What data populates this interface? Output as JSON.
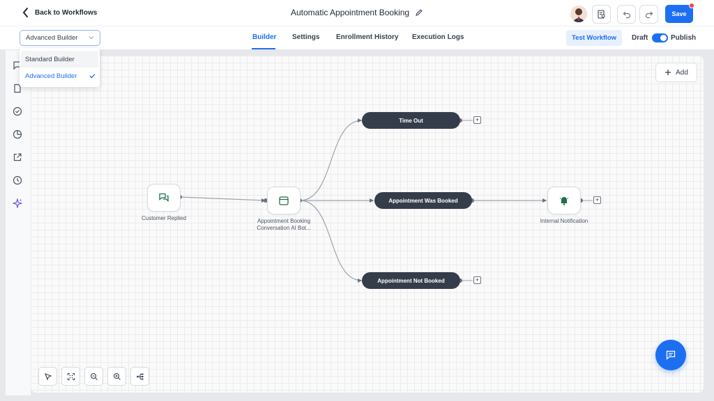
{
  "header": {
    "back_label": "Back to Workflows",
    "title": "Automatic Appointment Booking",
    "save_label": "Save"
  },
  "subbar": {
    "builder_select": "Advanced Builder",
    "tabs": [
      {
        "label": "Builder",
        "active": true
      },
      {
        "label": "Settings",
        "active": false
      },
      {
        "label": "Enrollment History",
        "active": false
      },
      {
        "label": "Execution Logs",
        "active": false
      }
    ],
    "test_label": "Test Workflow",
    "draft_label": "Draft",
    "publish_label": "Publish",
    "published": true
  },
  "dropdown": {
    "options": [
      {
        "label": "Standard Builder",
        "selected": false
      },
      {
        "label": "Advanced Builder",
        "selected": true
      }
    ]
  },
  "rail_icons": [
    "chat-icon",
    "document-icon",
    "check-circle-icon",
    "pie-chart-icon",
    "external-link-icon",
    "history-icon",
    "sparkle-icon"
  ],
  "canvas": {
    "add_label": "Add",
    "nodes": {
      "trigger": "Customer Replied",
      "action_line1": "Appointment Booking",
      "action_line2": "Conversation AI Bot...",
      "notify": "Internal Notification"
    },
    "branches": {
      "timeout": "Time Out",
      "booked": "Appointment Was Booked",
      "not_booked": "Appointment Not Booked"
    }
  },
  "toolbar_icons": [
    "pointer-icon",
    "fit-view-icon",
    "zoom-out-icon",
    "zoom-in-icon",
    "auto-layout-icon"
  ],
  "colors": {
    "accent": "#1d6ff2",
    "branch_pill": "#363d4a",
    "node_icon_green": "#1f6f4a"
  }
}
